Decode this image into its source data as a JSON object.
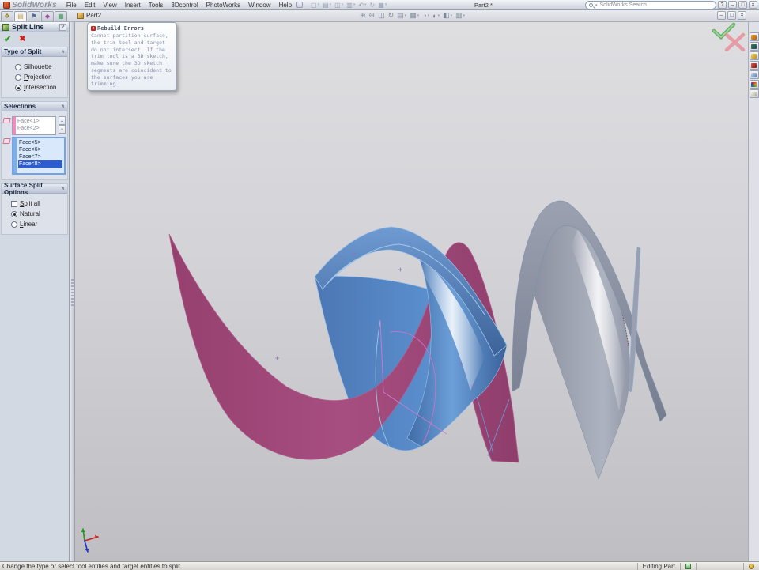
{
  "title_bar": {
    "app_name": "SolidWorks",
    "menus": [
      "File",
      "Edit",
      "View",
      "Insert",
      "Tools",
      "3Dcontrol",
      "PhotoWorks",
      "Window",
      "Help"
    ],
    "document_title": "Part2 *",
    "search_text": "SolidWorks Search",
    "help_label": "?"
  },
  "toolbar": {
    "flyout_part_label": "Part2"
  },
  "property_manager": {
    "title": "Split Line",
    "help": "?",
    "type_of_split": {
      "header": "Type of Split",
      "options": [
        {
          "label": "Silhouette",
          "selected": false
        },
        {
          "label": "Projection",
          "selected": false
        },
        {
          "label": "Intersection",
          "selected": true
        }
      ]
    },
    "selections": {
      "header": "Selections",
      "tool_faces": [
        "Face<1>",
        "Face<2>"
      ],
      "target_faces": [
        "Face<5>",
        "Face<6>",
        "Face<7>",
        "Face<8>"
      ],
      "target_selected": "Face<8>"
    },
    "surface_split_options": {
      "header": "Surface Split Options",
      "split_all_label": "Split all",
      "natural_label": "Natural",
      "linear_label": "Linear"
    }
  },
  "rebuild_error_tooltip": {
    "title": "Rebuild Errors",
    "message": "Cannot partition surface, the trim tool and target do not intersect. If the trim tool is a 3D sketch, make sure the 3D sketch segments are coincident to the surfaces you are trimming.",
    "error_glyph": "x"
  },
  "status_bar": {
    "message": "Change the type or select tool entities and target entities to split.",
    "mode": "Editing Part"
  },
  "icons": {
    "caret": "▾",
    "chevron_collapse": "∧",
    "ok_check": "✔",
    "cancel_x": "✖",
    "minimize": "–",
    "restore": "□",
    "close": "×",
    "spinner_up": "▲",
    "spinner_down": "▼",
    "quick_tools": [
      "▢",
      "▤",
      "◫",
      "▥",
      "↶",
      "↻",
      "▦"
    ],
    "view_tools": [
      "⊕",
      "⊖",
      "◫",
      "↻",
      "▤",
      "▦",
      "◔",
      "◐",
      "◧",
      "▥"
    ],
    "manager_tabs": [
      "❖",
      "▤",
      "⚑",
      "◆",
      "▦"
    ]
  },
  "colors": {
    "pink_surface": "#a0497c",
    "blue_surface": "#4f81c2",
    "gray_surface": "#9aa0af",
    "selection_highlight": "#2b5cd0",
    "tool_colorbar": "#f08cc0",
    "target_colorbar": "#76b0ee"
  }
}
